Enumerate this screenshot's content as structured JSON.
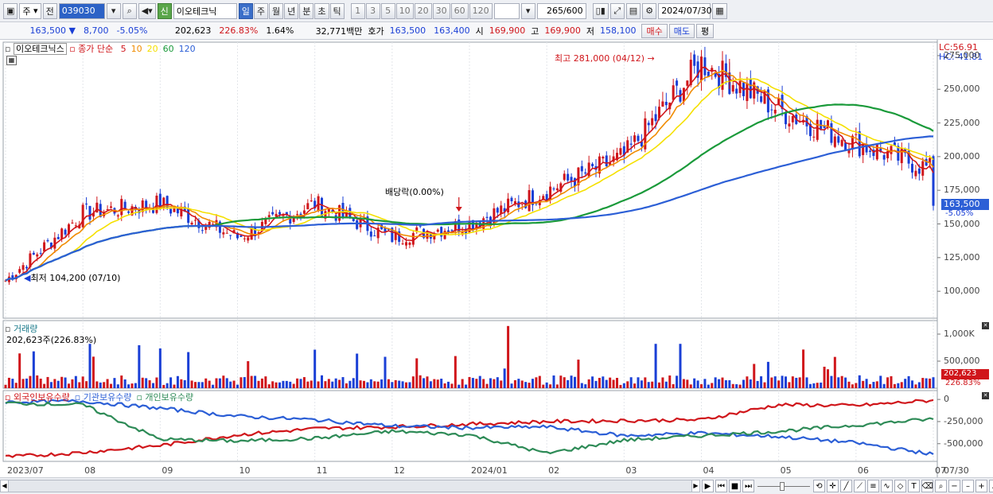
{
  "toolbar": {
    "period_unit": "주",
    "prev_label": "전",
    "stock_code": "039030",
    "stock_badge": "신",
    "stock_name": "이오테크닉",
    "tabs": [
      "일",
      "주",
      "월",
      "년",
      "분",
      "초",
      "틱"
    ],
    "selected_tab": "일",
    "intervals": [
      "1",
      "3",
      "5",
      "10",
      "20",
      "30",
      "60",
      "120"
    ],
    "count": "265",
    "count_max": "/600",
    "date": "2024/07/30"
  },
  "quote": {
    "price": "163,500",
    "change": "8,700",
    "change_pct": "-5.05%",
    "volume": "202,623",
    "volume_pct": "226.83%",
    "turnover_pct": "1.64%",
    "amount": "32,771백만",
    "bid_label": "호가",
    "bid1": "163,500",
    "bid2": "163,400",
    "open_label": "시",
    "open": "169,900",
    "high_label": "고",
    "high": "169,900",
    "low_label": "저",
    "low": "158,100",
    "buy_label": "매수",
    "sell_label": "매도",
    "eval_label": "평"
  },
  "price_pane": {
    "name": "이오테크닉스",
    "ma_title": "종가 단순",
    "ma_periods": [
      "5",
      "10",
      "20",
      "60",
      "120"
    ],
    "ma_colors": [
      "#d0161b",
      "#f08c00",
      "#f5e000",
      "#1a9a3a",
      "#2c5fd6"
    ],
    "lc_label": "LC:56.91",
    "hc_label": "HC:-41.81",
    "high_note": "최고 281,000 (04/12)",
    "low_note": "최저 104,200 (07/10)",
    "dividend_note": "배당락(0.00%)",
    "y_ticks": [
      "275,000",
      "250,000",
      "225,000",
      "200,000",
      "175,000",
      "150,000",
      "125,000",
      "100,000"
    ],
    "last_price_tag": "163,500",
    "last_pct_tag": "-5.05%"
  },
  "volume_pane": {
    "title": "거래량",
    "summary": "202,623주(226.83%)",
    "y_ticks": [
      "1,000K",
      "500,000"
    ],
    "last_tag": "202,623",
    "last_pct_tag": "226.83%"
  },
  "investor_pane": {
    "legend": [
      "외국인보유수량",
      "기관보유수량",
      "개인보유수량"
    ],
    "colors": [
      "#d0161b",
      "#2c5fd6",
      "#2e8b57"
    ],
    "y_ticks": [
      "0",
      "-250,000",
      "-500,000"
    ]
  },
  "x_axis": {
    "labels": [
      "2023/07",
      "08",
      "09",
      "10",
      "11",
      "12",
      "2024/01",
      "02",
      "03",
      "04",
      "05",
      "06",
      "07"
    ],
    "right_label": "07/30"
  },
  "chart_data": {
    "type": "line",
    "title": "",
    "price_ylim": [
      80000,
      285000
    ],
    "volume_ylim": [
      0,
      1250000
    ],
    "holdings_ylim": [
      -700000,
      100000
    ],
    "monthly_close": {
      "x": [
        "2023/07",
        "08",
        "09",
        "10",
        "11",
        "12",
        "2024/01",
        "02",
        "03",
        "04",
        "05",
        "06",
        "07"
      ],
      "values": [
        108000,
        158000,
        165000,
        140000,
        165000,
        140000,
        150000,
        175000,
        200000,
        270000,
        235000,
        210000,
        190000
      ]
    },
    "annotations": {
      "high": 281000,
      "low": 104200,
      "last": 163500
    }
  }
}
